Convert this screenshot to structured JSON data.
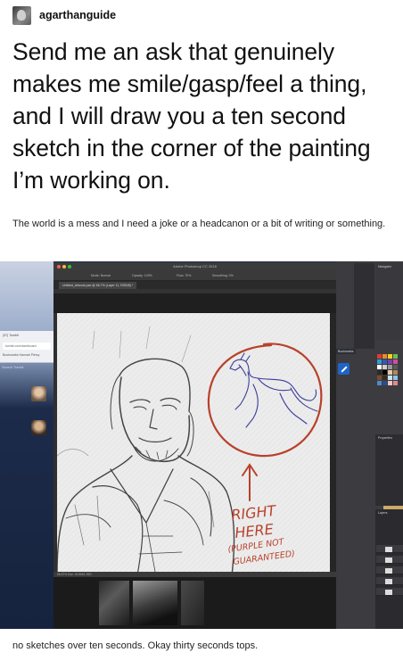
{
  "post": {
    "username": "agarthanguide",
    "headline": "Send me an ask that genuinely makes me smile/gasp/feel a thing, and I will draw you a ten second sketch in the corner of the painting I’m working on.",
    "subtext": "The world is a mess and I need a joke or a headcanon or a bit of writing or something.",
    "footer": "no sketches over ten seconds.  Okay thirty seconds tops."
  },
  "screenshot": {
    "app_title": "Adobe Photoshop CC 2018",
    "doc_tab": "Untitled_Artwork.psd @ 66.7% (Layer 11, RGB/8) *",
    "options_bar": [
      "Mode: Normal",
      "Opacity: 100%",
      "Flow: 70%",
      "Smoothing: 0%"
    ],
    "status_bar": "66.67%    Doc: 30.9M/1.39G",
    "browser_tab": "(37) Tumblr",
    "browser_url": "tumblr.com/dashboard",
    "bookmarks": "Bookmarks   Hannah Piercy",
    "search_label": "Search Tumblr",
    "bookmarks_right": "Bookmarks",
    "panels": {
      "navigator": "Navigator",
      "properties": "Properties",
      "layers": "Layers"
    },
    "swatch_colors": [
      "#e23b2e",
      "#f08a24",
      "#f6d21d",
      "#6cc04a",
      "#2aa1d8",
      "#2d5bb5",
      "#7a3fb0",
      "#d44d9a",
      "#ffffff",
      "#cfcfcf",
      "#9a9a9a",
      "#5a5a5a",
      "#2a2a2a",
      "#000000",
      "#e7c9a5",
      "#b88457",
      "#7a4d2a",
      "#3c2a1a",
      "#c7e3f5",
      "#8fc3e6",
      "#4d8cc7",
      "#274f8c",
      "#f4c4c4",
      "#e08a8a"
    ],
    "annotation": {
      "line1": "RIGHT",
      "line2": "HERE",
      "line3": "(PURPLE NOT",
      "line4": "GUARANTEED)"
    },
    "accent_colors": {
      "annotation_red": "#b8412b",
      "horse_blue": "#3b3c9a"
    }
  }
}
